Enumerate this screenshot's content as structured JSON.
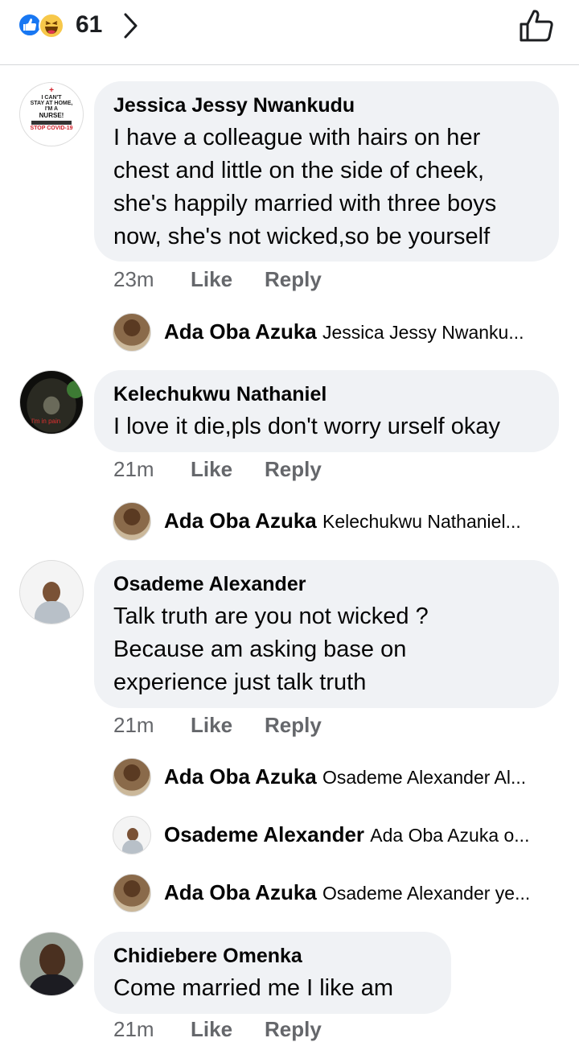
{
  "header": {
    "reaction_count": "61",
    "reactions": [
      "like-reaction-icon",
      "haha-reaction-icon"
    ]
  },
  "comments": [
    {
      "author": "Jessica Jessy Nwankudu",
      "text": "I have a colleague with hairs on her\nchest and little on the side of cheek,\nshe's happily married with three boys\nnow, she's not wicked,so be yourself",
      "time": "23m",
      "like": "Like",
      "reply": "Reply",
      "avatar_text": [
        "I CAN'T",
        "STAY AT HOME,",
        "I'M A",
        "NURSE!",
        "STOP COVID-19"
      ],
      "replies": [
        {
          "author": "Ada Oba Azuka",
          "preview": "Jessica Jessy Nwanku..."
        }
      ]
    },
    {
      "author": "Kelechukwu Nathaniel",
      "text": "I love it die,pls don't worry urself okay",
      "time": "21m",
      "like": "Like",
      "reply": "Reply",
      "avatar_text": "I'm in pain",
      "replies": [
        {
          "author": "Ada Oba Azuka",
          "preview": "Kelechukwu Nathaniel..."
        }
      ]
    },
    {
      "author": "Osademe Alexander",
      "text": "Talk truth are you not wicked ?\nBecause am asking base on\nexperience just talk truth",
      "time": "21m",
      "like": "Like",
      "reply": "Reply",
      "replies": [
        {
          "author": "Ada Oba Azuka",
          "preview": "Osademe Alexander Al..."
        },
        {
          "author": "Osademe Alexander",
          "preview": "Ada Oba Azuka o..."
        },
        {
          "author": "Ada Oba Azuka",
          "preview": "Osademe Alexander ye..."
        }
      ]
    },
    {
      "author": "Chidiebere Omenka",
      "text": "Come married me I like am",
      "time": "21m",
      "like": "Like",
      "reply": "Reply"
    }
  ],
  "colors": {
    "bubble": "#f0f2f5",
    "secondary_text": "#65676b",
    "like_blue": "#1877f2"
  }
}
